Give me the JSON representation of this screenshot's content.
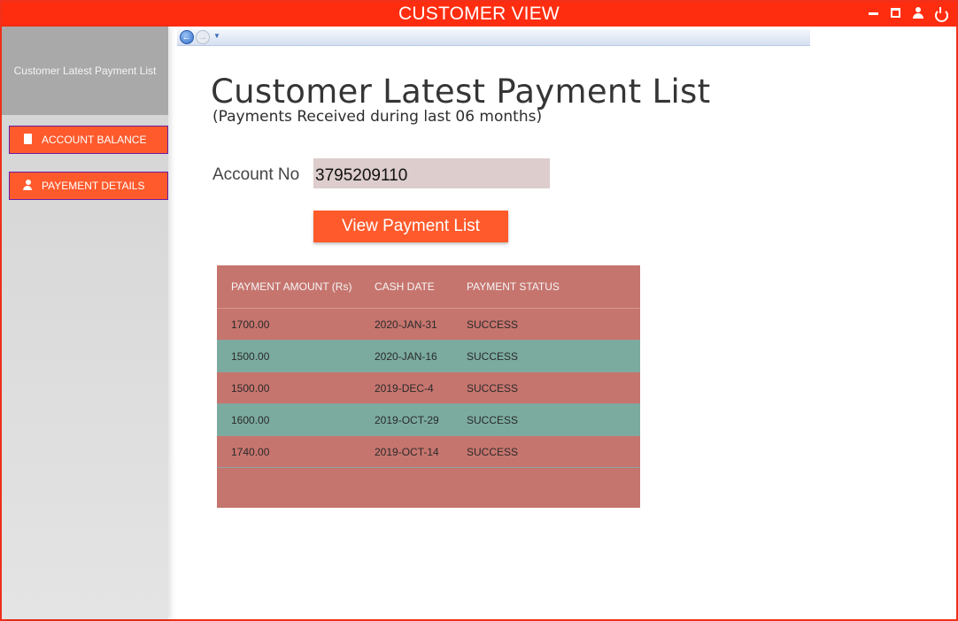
{
  "window": {
    "title": "CUSTOMER VIEW",
    "controls": [
      "minimize-icon",
      "maximize-icon",
      "user-icon",
      "power-icon"
    ]
  },
  "sidebar": {
    "header": "Customer Latest Payment List",
    "items": [
      {
        "label": "ACCOUNT BALANCE",
        "icon": "book-icon"
      },
      {
        "label": "PAYEMENT DETAILS",
        "icon": "user-payment-icon"
      }
    ]
  },
  "nav": {
    "back_icon": "back-arrow-icon",
    "forward_icon": "forward-arrow-icon",
    "history_icon": "history-dropdown-icon"
  },
  "main": {
    "title": "Customer Latest Payment List",
    "subtitle": "(Payments Received during last 06 months)",
    "account_label": "Account No",
    "account_value": "3795209110",
    "view_button": "View Payment List"
  },
  "table": {
    "columns": [
      "PAYMENT AMOUNT (Rs)",
      "CASH DATE",
      "PAYMENT STATUS"
    ],
    "rows": [
      [
        "1700.00",
        "2020-JAN-31",
        "SUCCESS"
      ],
      [
        "1500.00",
        "2020-JAN-16",
        "SUCCESS"
      ],
      [
        "1500.00",
        "2019-DEC-4",
        "SUCCESS"
      ],
      [
        "1600.00",
        "2019-OCT-29",
        "SUCCESS"
      ],
      [
        "1740.00",
        "2019-OCT-14",
        "SUCCESS"
      ]
    ]
  },
  "colors": {
    "titlebar": "#ff2d10",
    "button": "#ff5a2c",
    "row_red": "#c6756e",
    "row_teal": "#7bab9f",
    "input_bg": "#ddcdcd"
  }
}
